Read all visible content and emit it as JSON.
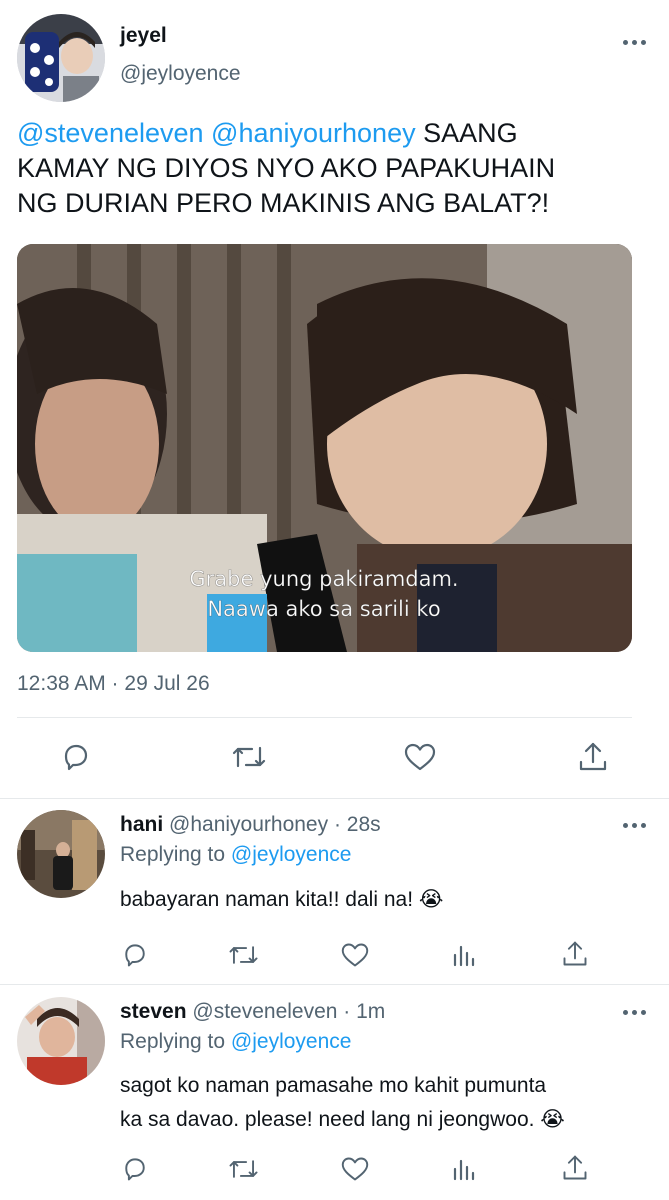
{
  "main_tweet": {
    "display_name": "jeyel",
    "handle": "@jeyloyence",
    "mention1": "@steveneleven",
    "mention2": "@haniyourhoney",
    "text_line1_rest": "SAANG",
    "text_line2": "KAMAY NG DIYOS NYO AKO PAPAKUHAIN",
    "text_line3": "NG DURIAN PERO MAKINIS ANG BALAT?!",
    "media_caption_line1": "Grabe yung pakiramdam.",
    "media_caption_line2": "Naawa ako sa sarili ko",
    "timestamp": "12:38 AM · 29 Jul 26",
    "actions": [
      "reply-icon",
      "retweet-icon",
      "like-icon",
      "share-icon"
    ]
  },
  "replies": [
    {
      "display_name": "hani",
      "handle_time": "@haniyourhoney · 28s",
      "replying_label": "Replying to",
      "replying_to": "@jeyloyence",
      "text": "babayaran naman kita!! dali na! 😭",
      "actions": [
        "reply-icon",
        "retweet-icon",
        "like-icon",
        "analytics-icon",
        "share-icon"
      ]
    },
    {
      "display_name": "steven",
      "handle_time": "@steveneleven · 1m",
      "replying_label": "Replying to",
      "replying_to": "@jeyloyence",
      "text_line1": "sagot ko naman pamasahe mo kahit pumunta",
      "text_line2": "ka sa davao. please! need lang ni jeongwoo. 😭",
      "actions": [
        "reply-icon",
        "retweet-icon",
        "like-icon",
        "analytics-icon",
        "share-icon"
      ]
    }
  ],
  "colors": {
    "link": "#1d9bf0",
    "secondary": "#536471",
    "text": "#0f1419",
    "divider": "#e6e9eb"
  }
}
